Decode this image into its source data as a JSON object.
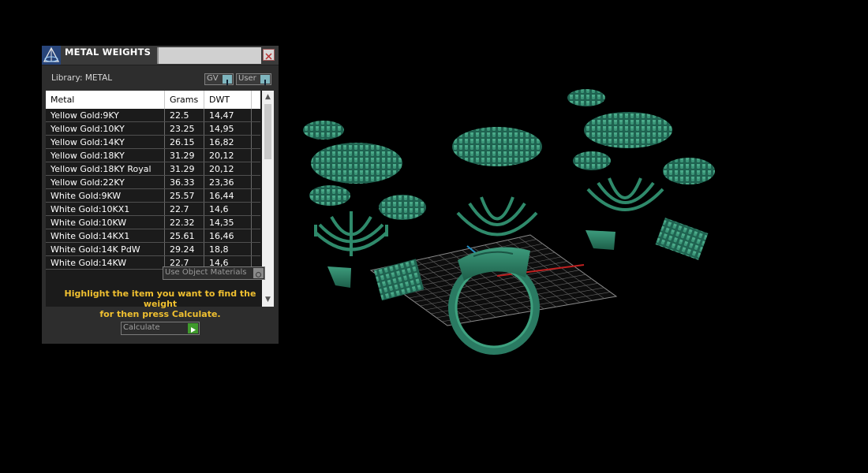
{
  "dialog": {
    "title": "METAL WEIGHTS",
    "library_label": "Library: METAL",
    "gv_button_label": "GV",
    "user_button_label": "User",
    "use_object_materials_label": "Use Object Materials",
    "hint_line1": "Highlight the item you want to find the weight",
    "hint_line2": "for then press Calculate.",
    "calculate_label": "Calculate"
  },
  "table": {
    "headers": [
      "Metal",
      "Grams",
      "DWT",
      ""
    ],
    "rows": [
      {
        "metal": "Yellow Gold:9KY",
        "grams": "22.5",
        "dwt": "14,47"
      },
      {
        "metal": "Yellow Gold:10KY",
        "grams": "23.25",
        "dwt": "14,95"
      },
      {
        "metal": "Yellow Gold:14KY",
        "grams": "26.15",
        "dwt": "16,82"
      },
      {
        "metal": "Yellow Gold:18KY",
        "grams": "31.29",
        "dwt": "20,12"
      },
      {
        "metal": "Yellow Gold:18KY Royal",
        "grams": "31.29",
        "dwt": "20,12"
      },
      {
        "metal": "Yellow Gold:22KY",
        "grams": "36.33",
        "dwt": "23,36"
      },
      {
        "metal": "White Gold:9KW",
        "grams": "25.57",
        "dwt": "16,44"
      },
      {
        "metal": "White Gold:10KX1",
        "grams": "22.7",
        "dwt": "14,6"
      },
      {
        "metal": "White Gold:10KW",
        "grams": "22.32",
        "dwt": "14,35"
      },
      {
        "metal": "White Gold:14KX1",
        "grams": "25.61",
        "dwt": "16,46"
      },
      {
        "metal": "White Gold:14K PdW",
        "grams": "29.24",
        "dwt": "18,8"
      },
      {
        "metal": "White Gold:14KW",
        "grams": "22.7",
        "dwt": "14,6"
      }
    ]
  },
  "icons": {
    "app_logo": "pyramid-logo-icon",
    "close": "close-icon",
    "scroll_up": "chevron-up-icon",
    "scroll_down": "chevron-down-icon",
    "calculate": "play-icon"
  },
  "colors": {
    "background": "#000000",
    "panel": "#2d2d2d",
    "hint_text": "#f0c030",
    "model_green": "#2a7a62",
    "grid_line": "#8c8c8c",
    "axis_red": "#c02020",
    "axis_blue": "#2090c8"
  }
}
